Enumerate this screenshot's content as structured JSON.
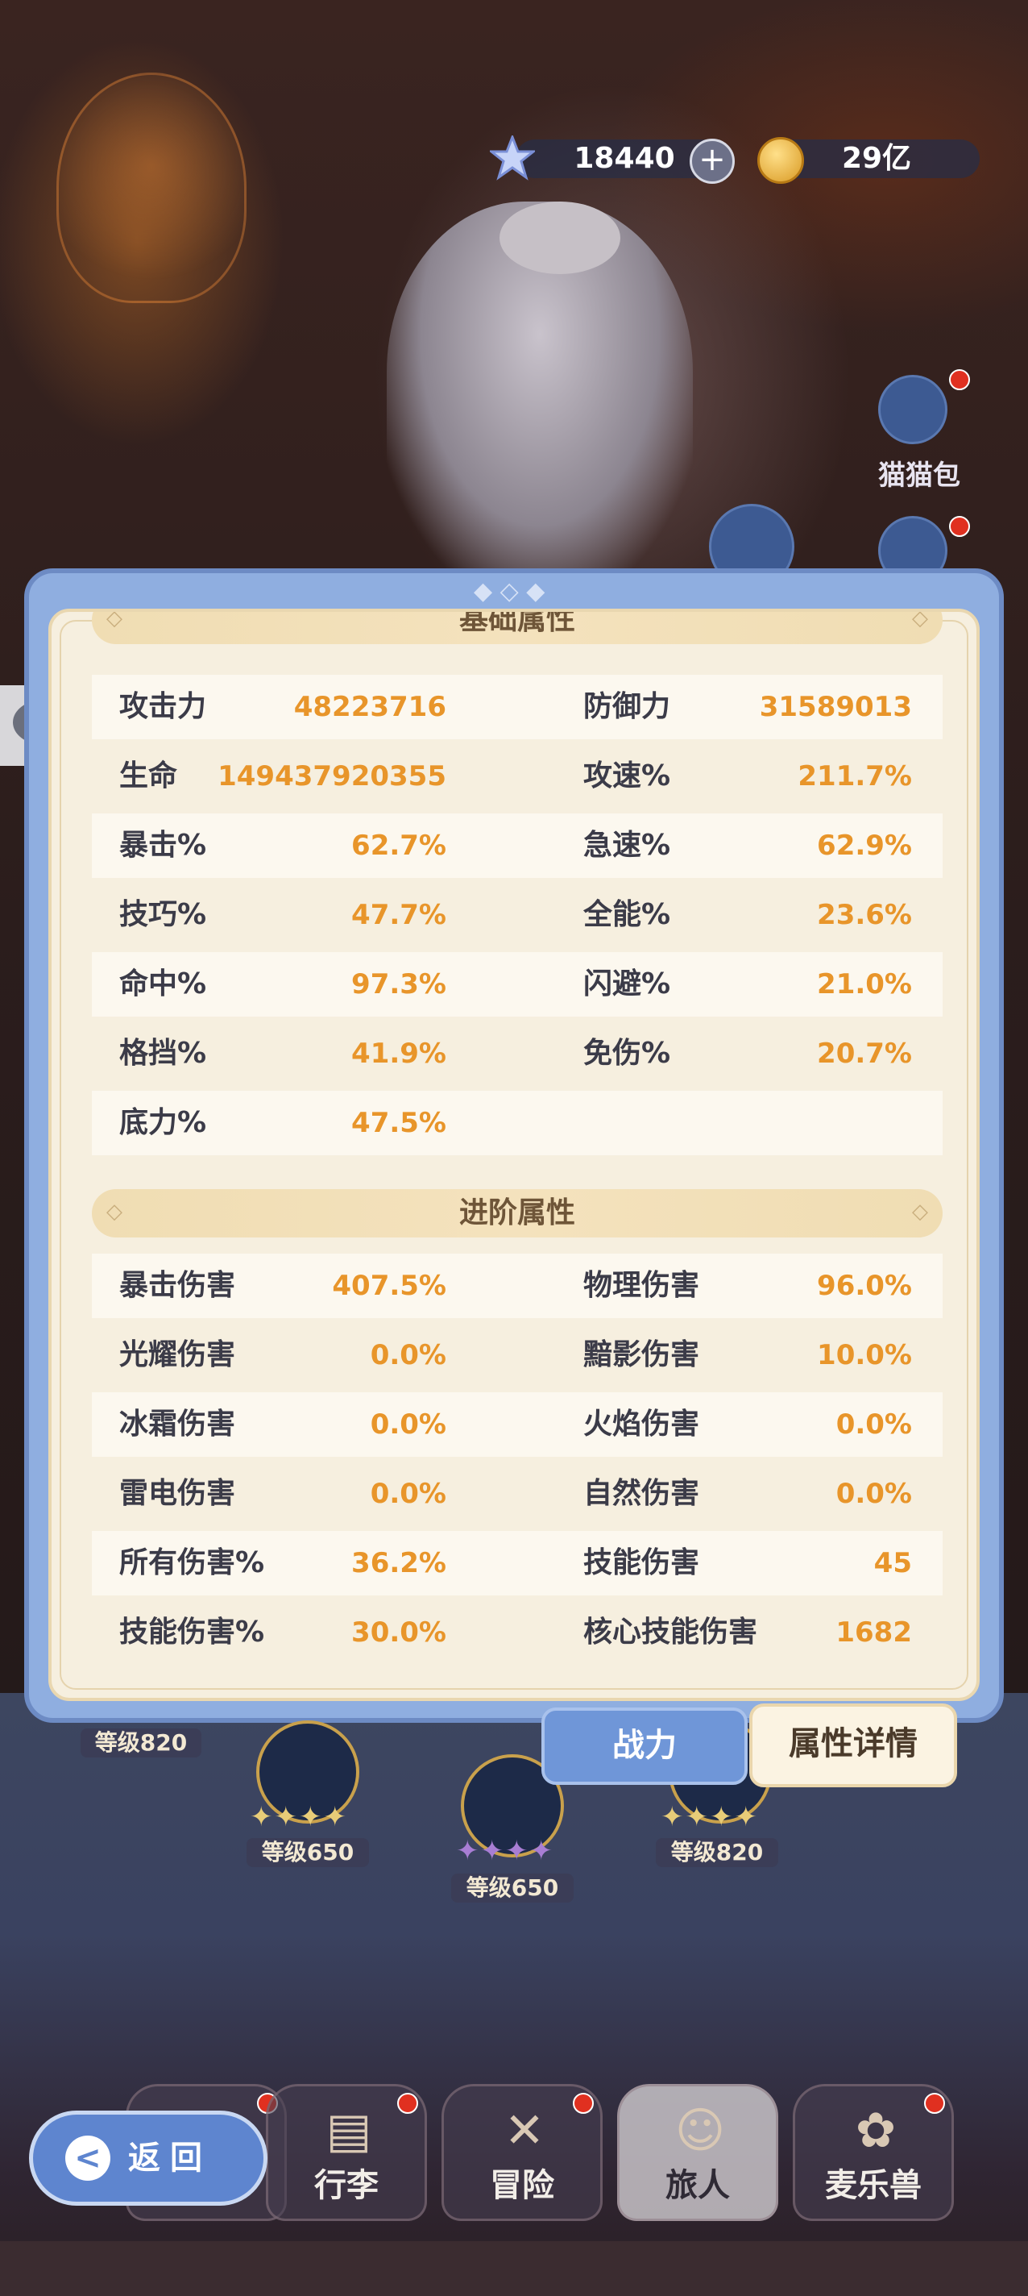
{
  "currency": {
    "gems": "18440",
    "gold": "29亿"
  },
  "side": {
    "cat_bag_label": "猫猫包"
  },
  "panel": {
    "basic_section_title": "基础属性",
    "basic_rows": [
      {
        "l1": "攻击力",
        "v1": "48223716",
        "l2": "防御力",
        "v2": "31589013"
      },
      {
        "l1": "生命",
        "v1": "149437920355",
        "l2": "攻速%",
        "v2": "211.7%"
      },
      {
        "l1": "暴击%",
        "v1": "62.7%",
        "l2": "急速%",
        "v2": "62.9%"
      },
      {
        "l1": "技巧%",
        "v1": "47.7%",
        "l2": "全能%",
        "v2": "23.6%"
      },
      {
        "l1": "命中%",
        "v1": "97.3%",
        "l2": "闪避%",
        "v2": "21.0%"
      },
      {
        "l1": "格挡%",
        "v1": "41.9%",
        "l2": "免伤%",
        "v2": "20.7%"
      },
      {
        "l1": "底力%",
        "v1": "47.5%",
        "l2": "",
        "v2": ""
      }
    ],
    "advanced_section_title": "进阶属性",
    "advanced_rows": [
      {
        "l1": "暴击伤害",
        "v1": "407.5%",
        "l2": "物理伤害",
        "v2": "96.0%"
      },
      {
        "l1": "光耀伤害",
        "v1": "0.0%",
        "l2": "黯影伤害",
        "v2": "10.0%"
      },
      {
        "l1": "冰霜伤害",
        "v1": "0.0%",
        "l2": "火焰伤害",
        "v2": "0.0%"
      },
      {
        "l1": "雷电伤害",
        "v1": "0.0%",
        "l2": "自然伤害",
        "v2": "0.0%"
      },
      {
        "l1": "所有伤害%",
        "v1": "36.2%",
        "l2": "技能伤害",
        "v2": "45"
      },
      {
        "l1": "技能伤害%",
        "v1": "30.0%",
        "l2": "核心技能伤害",
        "v2": "1682"
      }
    ]
  },
  "tabs": {
    "combat": "战力",
    "attr_detail": "属性详情"
  },
  "skills": {
    "lv1": "等级820",
    "lv2": "等级650",
    "lv3": "等级650",
    "lv4": "等级820"
  },
  "nav": {
    "back": "返回",
    "luggage": "行李",
    "adventure": "冒险",
    "traveler": "旅人",
    "pet": "麦乐兽"
  },
  "icons": {
    "gem": "star-gem-icon",
    "gold": "gold-coin-icon",
    "plus": "plus-icon",
    "chat": "chat-icon",
    "back": "back-arrow-icon"
  }
}
